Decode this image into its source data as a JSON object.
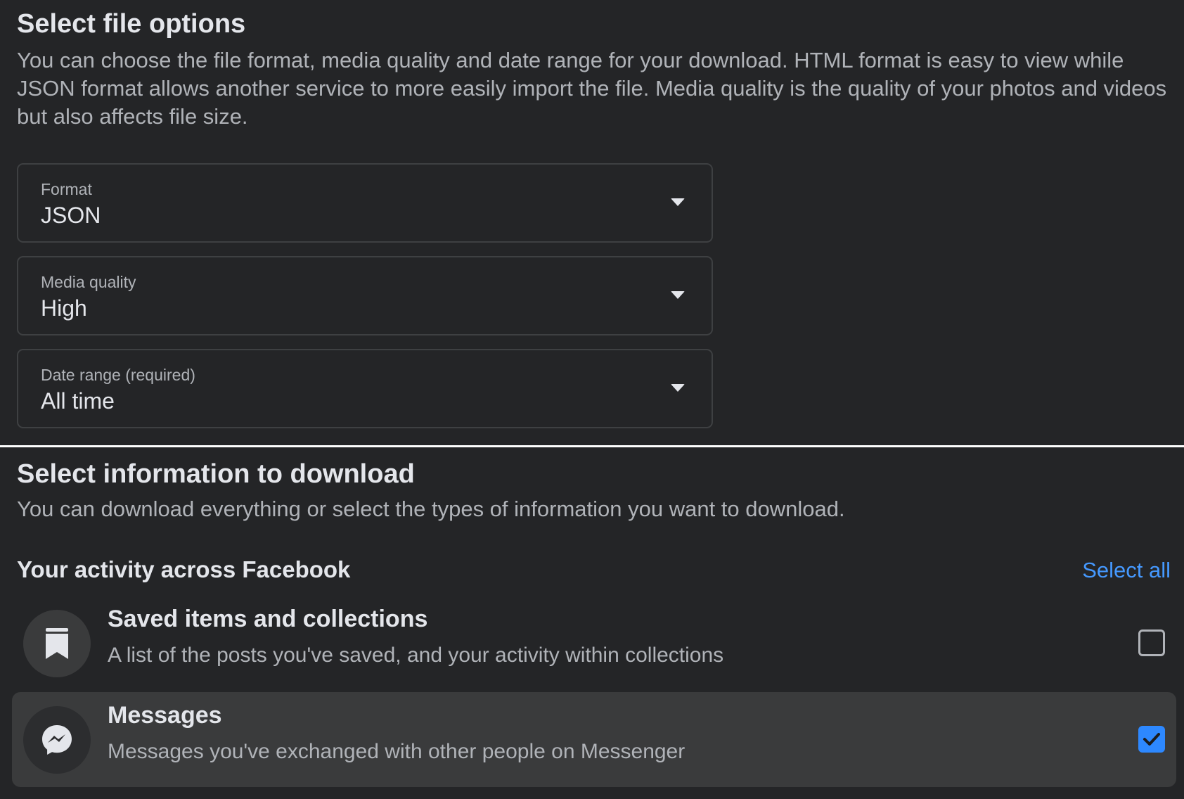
{
  "file_options": {
    "title": "Select file options",
    "description": "You can choose the file format, media quality and date range for your download. HTML format is easy to view while JSON format allows another service to more easily import the file. Media quality is the quality of your photos and videos but also affects file size.",
    "format": {
      "label": "Format",
      "value": "JSON"
    },
    "media_quality": {
      "label": "Media quality",
      "value": "High"
    },
    "date_range": {
      "label": "Date range (required)",
      "value": "All time"
    }
  },
  "info_download": {
    "title": "Select information to download",
    "description": "You can download everything or select the types of information you want to download.",
    "group_title": "Your activity across Facebook",
    "select_all_label": "Select all",
    "items": [
      {
        "title": "Saved items and collections",
        "subtitle": "A list of the posts you've saved, and your activity within collections",
        "icon": "bookmark-icon",
        "checked": false
      },
      {
        "title": "Messages",
        "subtitle": "Messages you've exchanged with other people on Messenger",
        "icon": "messenger-icon",
        "checked": true
      }
    ]
  },
  "colors": {
    "background": "#242527",
    "accent": "#2d88ff",
    "link": "#4599ff",
    "highlight_row": "#3a3b3c"
  }
}
